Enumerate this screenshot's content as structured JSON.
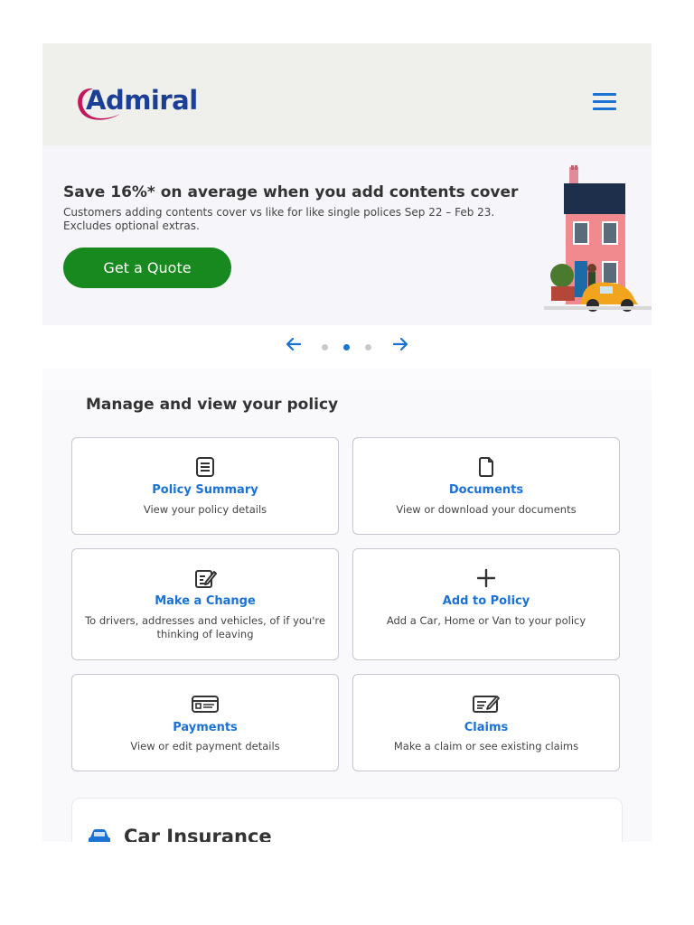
{
  "header": {
    "logo_text": "Admiral",
    "menu_icon": "hamburger-menu-icon"
  },
  "banner": {
    "title": "Save 16%* on average when you add contents cover",
    "description": "Customers adding contents cover vs like for like single polices Sep 22 – Feb 23. Excludes optional extras.",
    "cta_label": "Get a Quote",
    "cta_color": "#18891e"
  },
  "carousel": {
    "prev_icon": "arrow-left-icon",
    "next_icon": "arrow-right-icon",
    "slide_count": 3,
    "active_index": 1
  },
  "manage": {
    "title": "Manage and view your policy",
    "cards": [
      {
        "icon": "document-list-icon",
        "title": "Policy Summary",
        "description": "View your policy details"
      },
      {
        "icon": "document-icon",
        "title": "Documents",
        "description": "View or download your documents"
      },
      {
        "icon": "edit-icon",
        "title": "Make a Change",
        "description": "To drivers, addresses and vehicles, of if you're thinking of leaving"
      },
      {
        "icon": "plus-icon",
        "title": "Add to Policy",
        "description": "Add a Car, Home or Van to your policy"
      },
      {
        "icon": "card-icon",
        "title": "Payments",
        "description": "View or edit payment details"
      },
      {
        "icon": "claim-edit-icon",
        "title": "Claims",
        "description": "Make a claim or see existing claims"
      }
    ]
  },
  "car_insurance": {
    "icon": "car-icon",
    "title": "Car Insurance"
  },
  "colors": {
    "accent": "#1a72d4",
    "brand_navy": "#1b3f94",
    "brand_magenta": "#c2185b",
    "header_bg": "#efefec"
  }
}
